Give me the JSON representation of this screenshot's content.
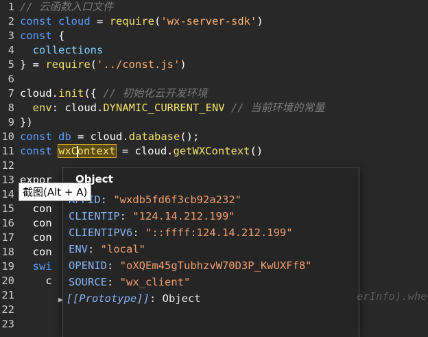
{
  "editor": {
    "line_numbers": [
      "1",
      "2",
      "3",
      "4",
      "5",
      "6",
      "7",
      "8",
      "9",
      "10",
      "11",
      "12",
      "13",
      "14",
      "15",
      "16",
      "17",
      "18",
      "19",
      "20",
      "21",
      "22",
      "23"
    ],
    "code": {
      "l1_comment": "// 云函数入口文件",
      "l2_kw": "const",
      "l2_var": "cloud",
      "l2_eq": " = ",
      "l2_fn": "require",
      "l2_open": "(",
      "l2_str": "'wx-server-sdk'",
      "l2_close": ")",
      "l3_kw": "const",
      "l3_rest": " {",
      "l4_prop": "collections",
      "l5_pre": "} = ",
      "l5_fn": "require",
      "l5_open": "(",
      "l5_str": "'../const.js'",
      "l5_close": ")",
      "l7_obj": "cloud.",
      "l7_fn": "init",
      "l7_open": "({ ",
      "l7_comment": "// 初始化云开发环境",
      "l8_prop": "env",
      "l8_colon": ": cloud.",
      "l8_const": "DYNAMIC_CURRENT_ENV",
      "l8_comment": " // 当前环境的常量",
      "l9": "})",
      "l10_kw": "const",
      "l10_var": "db",
      "l10_mid": " = cloud.",
      "l10_fn": "database",
      "l10_end": "();",
      "l11_kw": "const",
      "l11_word_a": "wxC",
      "l11_word_b": "ontext",
      "l11_mid": " = cloud.",
      "l11_fn": "getWXContext",
      "l11_end": "()",
      "l13": "expor",
      "l15": "  con",
      "l16": "  con",
      "l17": "  con",
      "l18": "  con",
      "l19": "  swi",
      "l20": "    c",
      "l21_clipped": "erInfo).whe"
    }
  },
  "popup": {
    "title": "Object",
    "properties": [
      {
        "key": "APPID",
        "value": "\"wxdb5fd6f3cb92a232\""
      },
      {
        "key": "CLIENTIP",
        "value": "\"124.14.212.199\""
      },
      {
        "key": "CLIENTIPV6",
        "value": "\"::ffff:124.14.212.199\""
      },
      {
        "key": "ENV",
        "value": "\"local\""
      },
      {
        "key": "OPENID",
        "value": "\"oXQEm45gTubhzvW70D3P_KwUXFf8\""
      },
      {
        "key": "SOURCE",
        "value": "\"wx_client\""
      }
    ],
    "prototype_key": "[[Prototype]]",
    "prototype_value": "Object",
    "colon": ": "
  },
  "tooltip": {
    "label": "截图(Alt + A)"
  },
  "colors": {
    "background": "#282828",
    "keyword": "#5aa0ff",
    "string": "#ffb070",
    "function": "#f2e36a",
    "comment": "#7c7c7c"
  }
}
